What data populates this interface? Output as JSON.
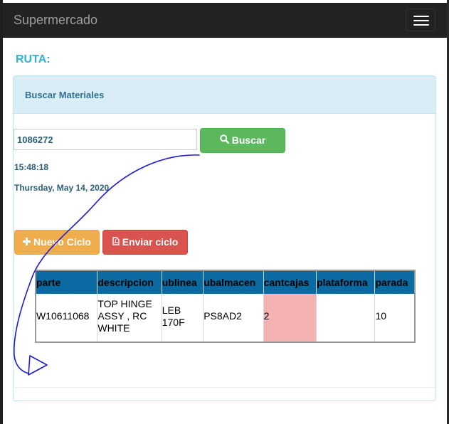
{
  "navbar": {
    "brand": "Supermercado"
  },
  "page": {
    "heading": "RUTA:"
  },
  "panel": {
    "title": "Buscar Materiales"
  },
  "search": {
    "value": "1086272",
    "button_label": "Buscar"
  },
  "clock": {
    "time": "15:48:18",
    "date": "Thursday, May 14, 2020"
  },
  "actions": {
    "nuevo_label": "Nuevo Ciclo",
    "enviar_label": "Enviar ciclo"
  },
  "table": {
    "headers": [
      "parte",
      "descripcion",
      "ublinea",
      "ubalmacen",
      "cantcajas",
      "plataforma",
      "parada"
    ],
    "rows": [
      {
        "parte": "W10611068",
        "descripcion": "TOP HINGE ASSY , RC WHITE",
        "ublinea": "LEB 170F",
        "ubalmacen": "PS8AD2",
        "cantcajas": "2",
        "plataforma": "",
        "parada": "10"
      }
    ]
  },
  "colors": {
    "navbar": "#222222",
    "accent": "#31b0d5",
    "success": "#5cb85c",
    "warning": "#f0ad4e",
    "danger": "#d9534f",
    "table_header": "#0a6aa1",
    "highlight_cell": "#f4b2b2",
    "annotation_ink": "#1a1ad8"
  },
  "icons": {
    "menu": "hamburger-icon",
    "search": "search-icon",
    "add": "plus-icon",
    "pdf": "file-pdf-icon"
  }
}
